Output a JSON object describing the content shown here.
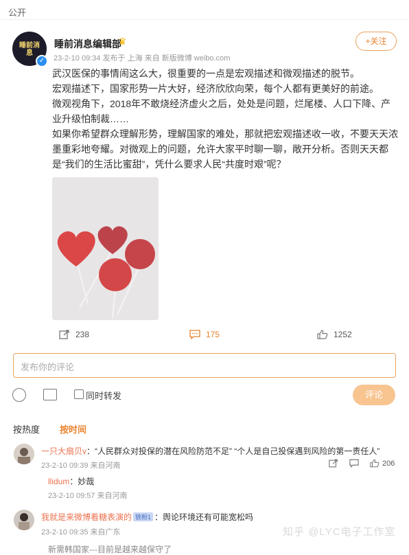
{
  "header": {
    "visibility": "公开"
  },
  "post": {
    "author": "睡前消息编辑部",
    "avatar_text": "睡前消息",
    "meta": "23-2-10 09:34  发布于 上海  来自 新版微博 weibo.com",
    "follow_label": "+关注",
    "paragraphs": [
      "武汉医保的事情闹这么大，很重要的一点是宏观描述和微观描述的脱节。",
      "宏观描述下，国家形势一片大好，经济欣欣向荣，每个人都有更美好的前途。",
      "微观视角下，2018年不敢烧经济虚火之后，处处是问题，烂尾楼、人口下降、产业升级怕制裁……",
      "如果你希望群众理解形势，理解国家的难处，那就把宏观描述收一收，不要天天浓墨重彩地夸耀。对微观上的问题，允许大家平时聊一聊，敞开分析。否则天天都是“我们的生活比蜜甜”，凭什么要求人民“共度时艰”呢？"
    ],
    "image_desc": "lollipops",
    "actions": {
      "share_count": "238",
      "comment_count": "175",
      "like_count": "1252"
    }
  },
  "composer": {
    "placeholder": "发布你的评论",
    "repost_label": "同时转发",
    "submit_label": "评论"
  },
  "sort": {
    "hot": "按热度",
    "time": "按时间"
  },
  "comments": [
    {
      "user": "一只大扇贝v",
      "text": "：“人民群众对投保的潜在风险防范不足” “个人是自己投保遇到风险的第一责任人”",
      "meta": "23-2-10 09:39  来自河南",
      "likes": "206",
      "reply": {
        "user": "llidum",
        "text": "：妙哉",
        "meta": "23-2-10 09:57  来自河南"
      }
    },
    {
      "user": "我就是来微博看糖表演的",
      "badge": "铁粉1",
      "text": "：舆论环境还有可能宽松吗",
      "meta": "23-2-10 09:35  来自广东",
      "reply_partial": "新需韩国家---目前是越来越保守了"
    }
  ],
  "watermark": "知乎 @LYC电子工作室",
  "colors": {
    "accent": "#e8822c",
    "link": "#eb7350",
    "verify": "#2a8ff0"
  }
}
